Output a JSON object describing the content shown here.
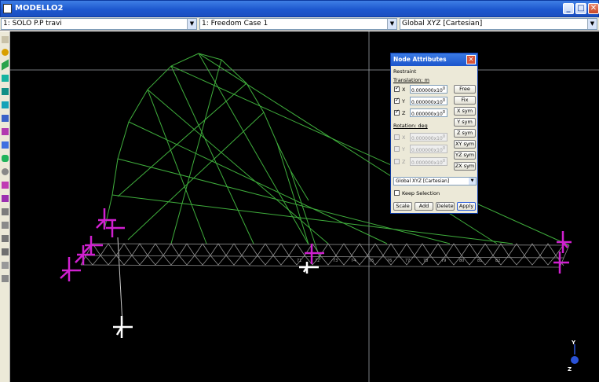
{
  "window": {
    "title": "MODELLO2",
    "minimize": "_",
    "restore": "□",
    "close": "✕"
  },
  "selectors": {
    "group": "1: SOLO P.P travi",
    "freedom_case": "1: Freedom Case 1",
    "coordinate_system": "Global XYZ [Cartesian]"
  },
  "dialog": {
    "title": "Node Attributes",
    "tab": "Restraint",
    "translation_label": "Translation: m",
    "rotation_label": "Rotation: deg",
    "translations": [
      {
        "axis": "X",
        "checked": true,
        "value": "0.000000x10"
      },
      {
        "axis": "Y",
        "checked": true,
        "value": "0.000000x10"
      },
      {
        "axis": "Z",
        "checked": true,
        "value": "0.000000x10"
      }
    ],
    "rotations": [
      {
        "axis": "X",
        "checked": false,
        "value": "0.000000x10"
      },
      {
        "axis": "Y",
        "checked": false,
        "value": "0.000000x10"
      },
      {
        "axis": "Z",
        "checked": false,
        "value": "0.000000x10"
      }
    ],
    "exponent": "0",
    "side_buttons": [
      "Free",
      "Fix",
      "X sym",
      "Y sym",
      "Z sym",
      "XY sym",
      "YZ sym",
      "ZX sym"
    ],
    "coord_system": "Global XYZ [Cartesian]",
    "keep_selection": "Keep Selection",
    "bottom_buttons": [
      "Scale",
      "Add",
      "Delete",
      "Apply"
    ]
  },
  "axis_gizmo": {
    "y": "Y",
    "z": "Z"
  },
  "node_numbers": [
    "71",
    "72",
    "73",
    "74",
    "75",
    "76",
    "77",
    "78",
    "79",
    "80",
    "81",
    "82"
  ],
  "colors": {
    "background": "#000000",
    "arch": "#3fae3c",
    "deck": "#8f8f8f",
    "restraint": "#d020d0",
    "selected": "#ffffff"
  }
}
